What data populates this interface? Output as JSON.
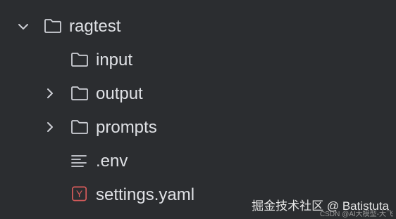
{
  "tree": {
    "items": [
      {
        "label": "ragtest",
        "type": "folder",
        "expanded": true
      },
      {
        "label": "input",
        "type": "folder"
      },
      {
        "label": "output",
        "type": "folder",
        "expanded": false
      },
      {
        "label": "prompts",
        "type": "folder",
        "expanded": false
      },
      {
        "label": ".env",
        "type": "text-file"
      },
      {
        "label": "settings.yaml",
        "type": "yaml-file",
        "icon_letter": "Y"
      }
    ]
  },
  "watermark": {
    "main": "掘金技术社区 @ Batistuta",
    "small": "CSDN @AI大模型-大飞"
  },
  "colors": {
    "background": "#2b2d30",
    "text": "#dfe1e5",
    "icon": "#ced0d6",
    "yaml_accent": "#db5c5c"
  }
}
